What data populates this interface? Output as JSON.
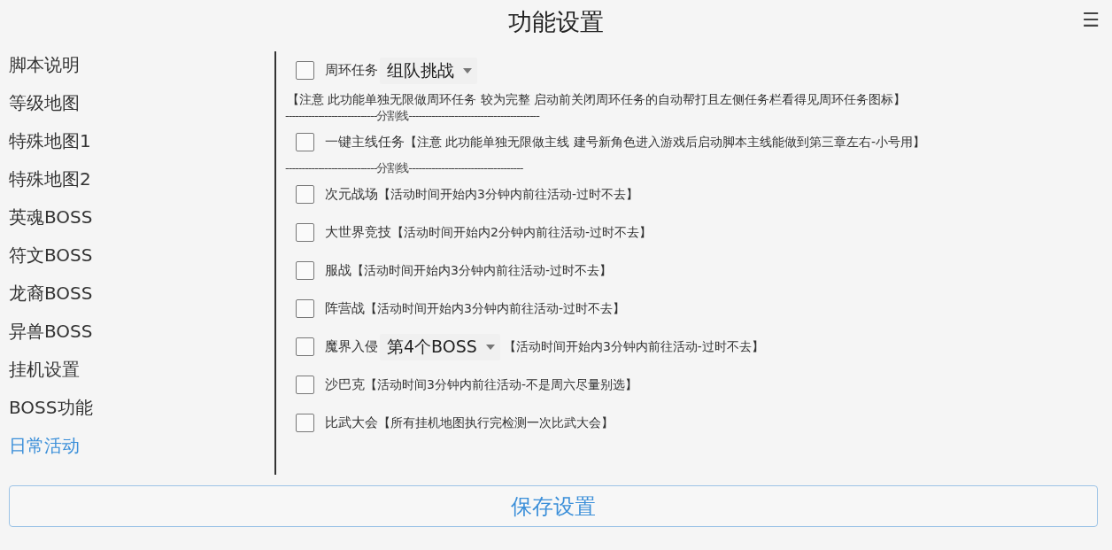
{
  "header": {
    "title": "功能设置",
    "menu_icon": "☰"
  },
  "sidebar": {
    "items": [
      {
        "label": "脚本说明",
        "selected": false
      },
      {
        "label": "等级地图",
        "selected": false
      },
      {
        "label": "特殊地图1",
        "selected": false
      },
      {
        "label": "特殊地图2",
        "selected": false
      },
      {
        "label": "英魂BOSS",
        "selected": false
      },
      {
        "label": "符文BOSS",
        "selected": false
      },
      {
        "label": "龙裔BOSS",
        "selected": false
      },
      {
        "label": "异兽BOSS",
        "selected": false
      },
      {
        "label": "挂机设置",
        "selected": false
      },
      {
        "label": "BOSS功能",
        "selected": false
      },
      {
        "label": "日常活动",
        "selected": true
      }
    ]
  },
  "options": [
    {
      "kind": "check",
      "label": "周环任务",
      "checked": false,
      "dropdown": "组队挑战"
    },
    {
      "kind": "note",
      "text": "【注意 此功能单独无限做周环任务 较为完整 启动前关闭周环任务的自动帮打且左侧任务栏看得见周环任务图标】"
    },
    {
      "kind": "divider",
      "text": "----------------------------分割线----------------------------------------"
    },
    {
      "kind": "check",
      "label": "一键主线任务",
      "checked": false,
      "note": "【注意 此功能单独无限做主线 建号新角色进入游戏后启动脚本主线能做到第三章左右-小号用】"
    },
    {
      "kind": "divider",
      "text": "----------------------------分割线-----------------------------------"
    },
    {
      "kind": "check",
      "label": "次元战场",
      "checked": false,
      "note": "【活动时间开始内3分钟内前往活动-过时不去】"
    },
    {
      "kind": "check",
      "label": "大世界竞技",
      "checked": false,
      "note": "【活动时间开始内2分钟内前往活动-过时不去】"
    },
    {
      "kind": "check",
      "label": "服战",
      "checked": false,
      "note": "【活动时间开始内3分钟内前往活动-过时不去】"
    },
    {
      "kind": "check",
      "label": "阵营战",
      "checked": false,
      "note": "【活动时间开始内3分钟内前往活动-过时不去】"
    },
    {
      "kind": "check",
      "label": "魔界入侵",
      "checked": false,
      "dropdown": "第4个BOSS",
      "note": "【活动时间开始内3分钟内前往活动-过时不去】"
    },
    {
      "kind": "check",
      "label": "沙巴克",
      "checked": false,
      "note": "【活动时间3分钟内前往活动-不是周六尽量别选】"
    },
    {
      "kind": "check",
      "label": "比武大会",
      "checked": false,
      "note": "【所有挂机地图执行完检测一次比武大会】"
    }
  ],
  "save_button": "保存设置"
}
